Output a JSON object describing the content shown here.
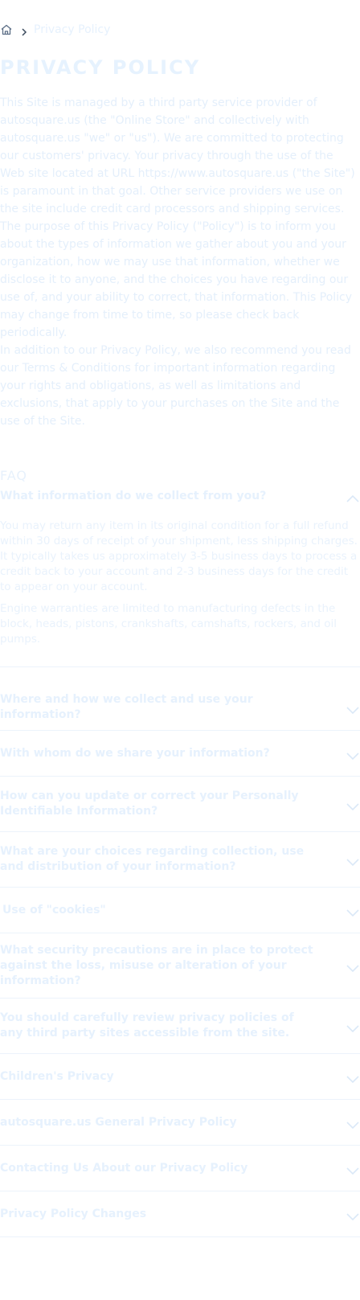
{
  "breadcrumb": {
    "home_icon": "home-icon",
    "separator_icon": "chevron-right-icon",
    "current": "Privacy Policy"
  },
  "page": {
    "title": "PRIVACY POLICY",
    "intro": [
      "This Site is managed by a third party service provider of autosquare.us (the \"Online Store\" and collectively with autosquare.us \"we\" or \"us\"). We are committed to protecting our customers' privacy. Your privacy through the use of the Web site located at URL https://www.autosquare.us (\"the Site\") is paramount in that goal. Other service providers we use on the site include credit card processors and shipping services.",
      "The purpose of this Privacy Policy (\"Policy\") is to inform you about the types of information we gather about you and your organization, how we may use that information, whether we disclose it to anyone, and the choices you have regarding our use of, and your ability to correct, that information. This Policy may change from time to time, so please check back periodically.",
      "In addition to our Privacy Policy, we also recommend you read our Terms & Conditions for important information regarding your rights and obligations, as well as limitations and exclusions, that apply to your purchases on the Site and the use of the Site."
    ],
    "faq_heading": "FAQ"
  },
  "faq": [
    {
      "question": "What information do we collect from you?",
      "expanded": true,
      "answer": [
        "You may return any item in its original condition for a full refund within 30 days of receipt of your shipment, less shipping charges. It typically takes us approximately 3-5 business days to process a credit back to your account and 2-3 business days for the credit to appear on your account.",
        "Engine warranties are limited to manufacturing defects in the block, heads, pistons, crankshafts, camshafts, rockers, and oil pumps."
      ]
    },
    {
      "question": "Where and how we collect and use your information?",
      "expanded": false
    },
    {
      "question": "With whom do we share your information?",
      "expanded": false
    },
    {
      "question": "How can you update or correct your Personally Identifiable Information?",
      "expanded": false
    },
    {
      "question": "What are your choices regarding collection, use and distribution of your information?",
      "expanded": false
    },
    {
      "question": "Use of \"cookies\"",
      "expanded": false
    },
    {
      "question": "What security precautions are in place to protect against the loss, misuse or alteration of your information?",
      "expanded": false
    },
    {
      "question": "You should carefully review privacy policies of any third party sites accessible from the site.",
      "expanded": false
    },
    {
      "question": "Children's Privacy",
      "expanded": false
    },
    {
      "question": "autosquare.us General Privacy Policy",
      "expanded": false
    },
    {
      "question": "Contacting Us About our Privacy Policy",
      "expanded": false
    },
    {
      "question": "Privacy Policy Changes",
      "expanded": false
    }
  ]
}
